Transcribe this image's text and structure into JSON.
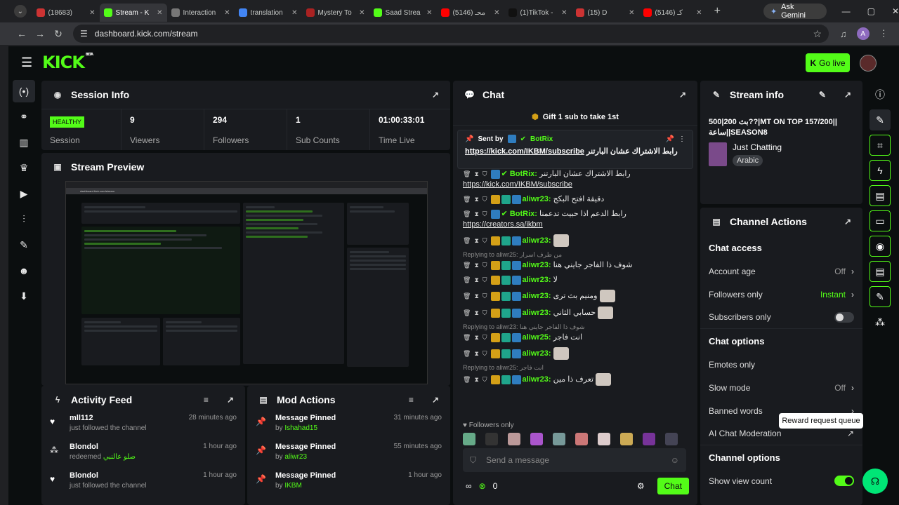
{
  "browser": {
    "tabs": [
      {
        "title": "(18683)",
        "color": "#cc3333",
        "active": false
      },
      {
        "title": "Stream - K",
        "color": "#53fc18",
        "active": true
      },
      {
        "title": "Interaction",
        "color": "#777777",
        "active": false
      },
      {
        "title": "translation",
        "color": "#4285f4",
        "active": false
      },
      {
        "title": "Mystery To",
        "color": "#aa2222",
        "active": false
      },
      {
        "title": "Saad Strea",
        "color": "#53fc18",
        "active": false
      },
      {
        "title": "(5146) محـ",
        "color": "#ff0000",
        "active": false
      },
      {
        "title": "(1)TikTok -",
        "color": "#111111",
        "active": false
      },
      {
        "title": "(15) D",
        "color": "#cc3333",
        "active": false
      },
      {
        "title": "(5146) کـ",
        "color": "#ff0000",
        "active": false
      }
    ],
    "gemini_label": "Ask Gemini",
    "url": "dashboard.kick.com/stream",
    "profile_letter": "A"
  },
  "header": {
    "logo": "KICK",
    "beta": "BETA",
    "go_live": "Go live"
  },
  "session": {
    "title": "Session Info",
    "health": "HEALTHY",
    "health_label": "Session",
    "stats": [
      {
        "value": "9",
        "label": "Viewers"
      },
      {
        "value": "294",
        "label": "Followers"
      },
      {
        "value": "1",
        "label": "Sub Counts"
      },
      {
        "value": "01:00:33:01",
        "label": "Time Live"
      }
    ]
  },
  "preview": {
    "title": "Stream Preview",
    "url": "dashboard.kick.com/stream"
  },
  "activity": {
    "title": "Activity Feed",
    "items": [
      {
        "name": "mll112",
        "sub": "just followed the channel",
        "time": "28 minutes ago",
        "icon": "heart-icon"
      },
      {
        "name": "Blondol",
        "sub": "redeemed",
        "sub_green": "صلو عالنبي",
        "time": "1 hour ago",
        "icon": "reward-icon"
      },
      {
        "name": "Blondol",
        "sub": "just followed the channel",
        "time": "1 hour ago",
        "icon": "heart-icon"
      }
    ]
  },
  "mod": {
    "title": "Mod Actions",
    "items": [
      {
        "action": "Message Pinned",
        "by": "by",
        "user": "Ishahad15",
        "time": "31 minutes ago"
      },
      {
        "action": "Message Pinned",
        "by": "by",
        "user": "aliwr23",
        "time": "55 minutes ago"
      },
      {
        "action": "Message Pinned",
        "by": "by",
        "user": "IKBM",
        "time": "1 hour ago"
      }
    ]
  },
  "chat": {
    "title": "Chat",
    "gift_banner": "Gift 1 sub to take 1st",
    "pinned": {
      "sent_by": "Sent by",
      "user": "BotRix",
      "text": "رابط الاشتراك عشان البارتنر",
      "link": "https://kick.com/IKBM/subscribe"
    },
    "messages": [
      {
        "reply": "",
        "user": "BotRix",
        "text": "رابط الاشتراك عشان البارتنر",
        "link": "https://kick.com/IKBM/subscribe",
        "emote": false
      },
      {
        "reply": "",
        "user": "aliwr23",
        "text": "دقيقة افتح البكج",
        "link": "",
        "emote": false
      },
      {
        "reply": "",
        "user": "BotRix",
        "text": "رابط الدعم اذا حبيت تدعمنا",
        "link": "https://creators.sa/ikbm",
        "emote": false
      },
      {
        "reply": "",
        "user": "aliwr23",
        "text": "",
        "link": "",
        "emote": true
      },
      {
        "reply": "Replying to aliwr25: من طرف اسرار",
        "user": "aliwr23",
        "text": "شوف ذا الفاجر جايني هنا",
        "link": "",
        "emote": false
      },
      {
        "reply": "",
        "user": "aliwr23",
        "text": "لا",
        "link": "",
        "emote": false
      },
      {
        "reply": "",
        "user": "aliwr23",
        "text": "ومنيم بث ترى",
        "link": "",
        "emote": true
      },
      {
        "reply": "",
        "user": "aliwr23",
        "text": "حسابي الثاني",
        "link": "",
        "emote": true
      },
      {
        "reply": "Replying to aliwr23: شوف ذا الفاجر جايني هنا",
        "user": "aliwr25",
        "text": "انت فاجر",
        "link": "",
        "emote": false
      },
      {
        "reply": "",
        "user": "aliwr23",
        "text": "",
        "link": "",
        "emote": true
      },
      {
        "reply": "Replying to aliwr25: انت فاجر",
        "user": "aliwr23",
        "text": "تعرف ذا مين",
        "link": "",
        "emote": true
      }
    ],
    "followers_only": "Followers only",
    "input_placeholder": "Send a message",
    "kicks_count": "0",
    "chat_button": "Chat"
  },
  "stream_info": {
    "title": "Stream info",
    "stream_title": "بث 200|500??|MT ON TOP 157/200||ساعة||SEASON8",
    "category": "Just Chatting",
    "language": "Arabic"
  },
  "channel_actions": {
    "title": "Channel Actions",
    "chat_access_title": "Chat access",
    "account_age": {
      "label": "Account age",
      "value": "Off"
    },
    "followers_only": {
      "label": "Followers only",
      "value": "Instant"
    },
    "subscribers_only": {
      "label": "Subscribers only"
    },
    "chat_options_title": "Chat options",
    "emotes_only": {
      "label": "Emotes only"
    },
    "slow_mode": {
      "label": "Slow mode",
      "value": "Off"
    },
    "banned_words": {
      "label": "Banned words"
    },
    "ai_moderation": {
      "label": "AI Chat Moderation"
    },
    "channel_options_title": "Channel options",
    "show_view_count": {
      "label": "Show view count"
    }
  },
  "tooltip": "Reward request queue",
  "colors": {
    "accent": "#53fc18",
    "panel": "#191b1f",
    "page": "#0b0e0f"
  }
}
